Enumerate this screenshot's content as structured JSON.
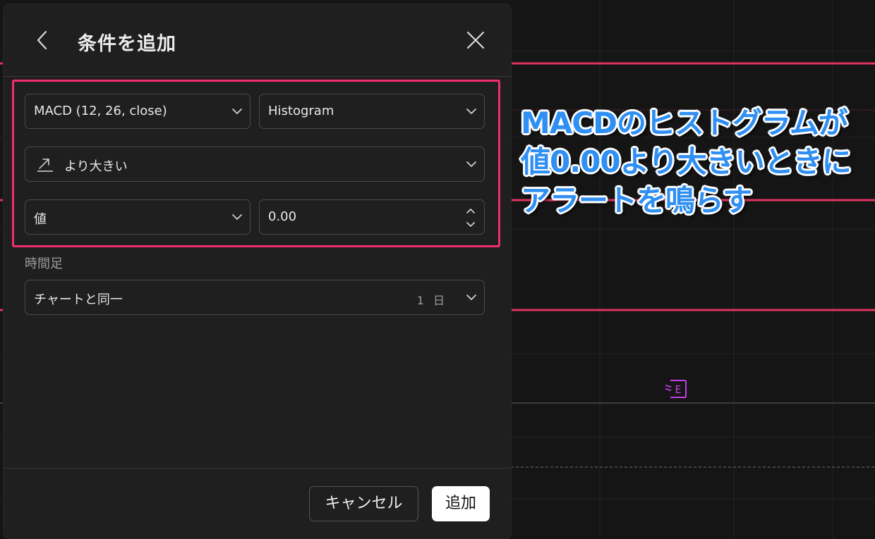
{
  "dialog": {
    "title": "条件を追加",
    "condition": {
      "indicator": "MACD (12, 26, close)",
      "plot": "Histogram",
      "operator": "より大きい",
      "value_source": "値",
      "value": "0.00"
    },
    "timeframe": {
      "label": "時間足",
      "value": "チャートと同一",
      "interval": "1 日"
    },
    "footer": {
      "cancel_label": "キャンセル",
      "add_label": "追加"
    }
  },
  "annotation": {
    "lines": [
      "MACDのヒストグラムが",
      "値0.00より大きいときに",
      "アラートを鳴らす"
    ]
  },
  "chart": {
    "earnings_badge": "E"
  },
  "colors": {
    "highlight": "#ef2f6a",
    "annotation_text": "#2f8ff2",
    "chart_line": "#e0325f",
    "earnings_badge": "#c13fe8"
  },
  "icons": {
    "back": "chevron-left-icon",
    "close": "close-icon",
    "dropdown": "chevron-down-icon",
    "operator": "trend-up-icon",
    "stepper": "stepper-icon",
    "earnings": "earnings-icon"
  }
}
